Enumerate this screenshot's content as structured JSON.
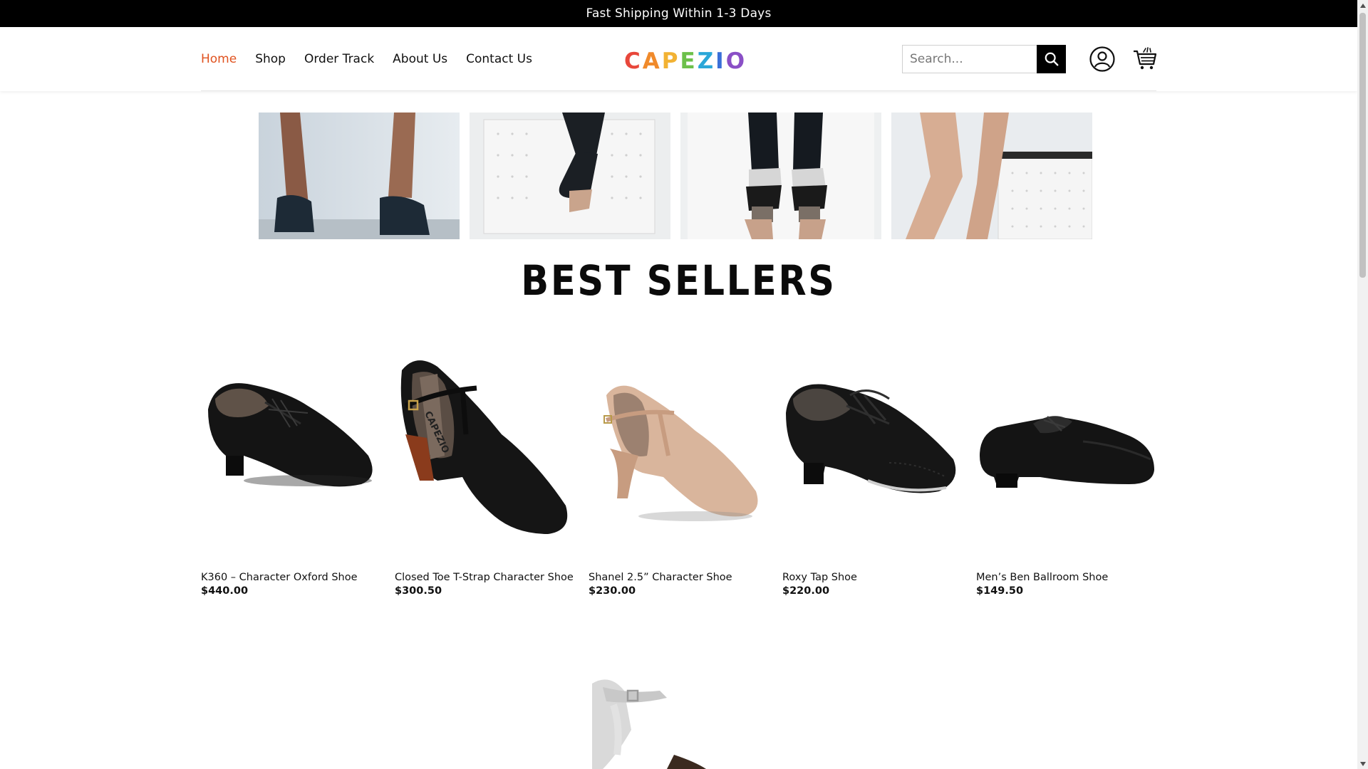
{
  "announcement": "Fast Shipping Within 1-3 Days",
  "nav": {
    "items": [
      {
        "label": "Home",
        "active": true
      },
      {
        "label": "Shop",
        "active": false
      },
      {
        "label": "Order Track",
        "active": false
      },
      {
        "label": "About Us",
        "active": false
      },
      {
        "label": "Contact Us",
        "active": false
      }
    ]
  },
  "logo": {
    "letters": [
      "C",
      "A",
      "P",
      "E",
      "Z",
      "I",
      "O"
    ],
    "colors": [
      "#e8473b",
      "#f08a2b",
      "#f2b233",
      "#6cc04a",
      "#2aa7d8",
      "#3a6fd8",
      "#8a4fc6"
    ]
  },
  "search": {
    "placeholder": "Search...",
    "button_icon": "search-icon"
  },
  "header_icons": {
    "account": "user-account-icon",
    "cart": "shopping-cart-icon"
  },
  "hero": {
    "tiles": [
      "dancer-feet-photo-1",
      "dancer-feet-photo-2",
      "dancer-feet-photo-3",
      "dancer-feet-photo-4"
    ]
  },
  "best_sellers": {
    "title": "BEST SELLERS",
    "products": [
      {
        "name": "K360 – Character Oxford Shoe",
        "price": "$440.00",
        "image": "black-oxford-character-shoe"
      },
      {
        "name": "Closed Toe T-Strap Character Shoe",
        "price": "$300.50",
        "image": "black-t-strap-heel-shoe"
      },
      {
        "name": "Shanel 2.5” Character Shoe",
        "price": "$230.00",
        "image": "tan-t-strap-heel-shoe"
      },
      {
        "name": "Roxy Tap Shoe",
        "price": "$220.00",
        "image": "black-wingtip-tap-shoe"
      },
      {
        "name": "Men’s Ben Ballroom Shoe",
        "price": "$149.50",
        "image": "black-ballroom-shoe"
      }
    ]
  },
  "colors": {
    "accent": "#e0521f",
    "topbar": "#000000"
  }
}
